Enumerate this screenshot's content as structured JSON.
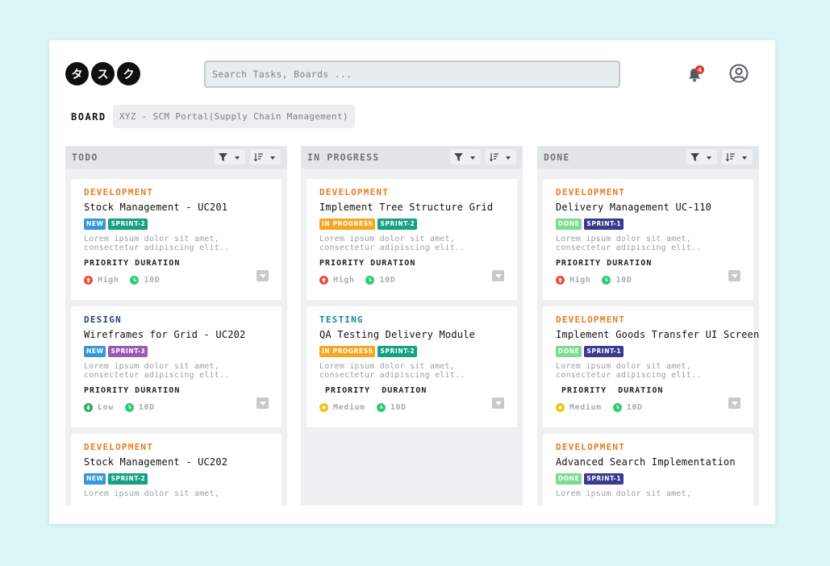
{
  "logo": [
    "タ",
    "ス",
    "ク"
  ],
  "search": {
    "placeholder": "Search Tasks, Boards ..."
  },
  "header": {
    "notification_count": "4",
    "bell_icon": "bell-icon",
    "user_icon": "user-circle-icon"
  },
  "board": {
    "label": "BOARD",
    "name": "XYZ - SCM Portal(Supply Chain Management)"
  },
  "colors": {
    "development": "#e67e22",
    "design": "#2c3e7a",
    "testing": "#1a8a8a",
    "new": "#3498db",
    "in_progress": "#f5a623",
    "done": "#7ddc8f",
    "sprint1": "#3b3a8f",
    "sprint2": "#16a085",
    "sprint3": "#9b59b6",
    "high": "#e74c3c",
    "low": "#27ae60",
    "medium": "#f1c40f",
    "duration": "#2ecc71"
  },
  "columns": [
    {
      "title": "TODO",
      "cards": [
        {
          "category": "DEVELOPMENT",
          "title": "Stock Management - UC201",
          "status": "NEW",
          "sprint": "SPRINT-2",
          "desc1": "Lorem ipsum dolor sit amet,",
          "desc2": "consectetur adipiscing elit..",
          "meta_label": "PRIORITY DURATION",
          "priority": "High",
          "duration": "10D"
        },
        {
          "category": "DESIGN",
          "title": "Wireframes for Grid - UC202",
          "status": "NEW",
          "sprint": "SPRINT-3",
          "desc1": "Lorem ipsum dolor sit amet,",
          "desc2": "consectetur adipiscing elit..",
          "meta_label": "PRIORITY DURATION",
          "priority": "Low",
          "duration": "10D"
        },
        {
          "category": "DEVELOPMENT",
          "title": "Stock Management - UC202",
          "status": "NEW",
          "sprint": "SPRINT-2",
          "desc1": "Lorem ipsum dolor sit amet,",
          "desc2": "",
          "meta_label": "",
          "priority": "",
          "duration": ""
        }
      ]
    },
    {
      "title": "IN PROGRESS",
      "cards": [
        {
          "category": "DEVELOPMENT",
          "title": "Implement Tree Structure Grid",
          "status": "IN PROGRESS",
          "sprint": "SPRINT-2",
          "desc1": "Lorem ipsum dolor sit amet,",
          "desc2": "consectetur adipiscing elit..",
          "meta_label": "PRIORITY DURATION",
          "priority": "High",
          "duration": "10D"
        },
        {
          "category": "TESTING",
          "title": "QA Testing Delivery Module",
          "status": "IN PROGRESS",
          "sprint": "SPRINT-2",
          "desc1": "Lorem ipsum dolor sit amet,",
          "desc2": "consectetur adipiscing elit..",
          "meta_label": " PRIORITY  DURATION",
          "priority": "Medium",
          "duration": "10D"
        }
      ]
    },
    {
      "title": "DONE",
      "cards": [
        {
          "category": "DEVELOPMENT",
          "title": "Delivery Management UC-110",
          "status": "DONE",
          "sprint": "SPRINT-1",
          "desc1": "Lorem ipsum dolor sit amet,",
          "desc2": "consectetur adipiscing elit..",
          "meta_label": "PRIORITY DURATION",
          "priority": "High",
          "duration": "10D"
        },
        {
          "category": "DEVELOPMENT",
          "title": "Implement Goods Transfer UI Screen",
          "status": "DONE",
          "sprint": "SPRINT-1",
          "desc1": "Lorem ipsum dolor sit amet,",
          "desc2": "consectetur adipiscing elit..",
          "meta_label": " PRIORITY  DURATION",
          "priority": "Medium",
          "duration": "10D"
        },
        {
          "category": "DEVELOPMENT",
          "title": "Advanced Search Implementation",
          "status": "DONE",
          "sprint": "SPRINT-1",
          "desc1": "Lorem ipsum dolor sit amet,",
          "desc2": "",
          "meta_label": "",
          "priority": "",
          "duration": ""
        }
      ]
    }
  ]
}
